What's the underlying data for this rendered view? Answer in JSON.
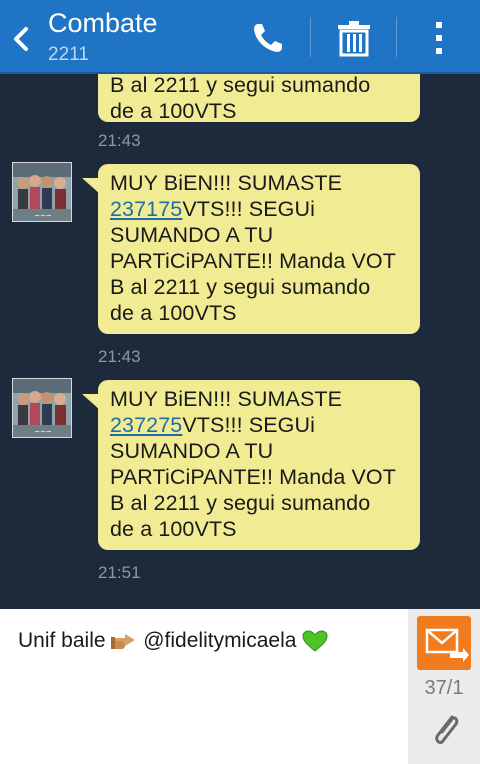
{
  "header": {
    "title": "Combate",
    "subtitle": "2211",
    "icons": {
      "back": "chevron-left-icon",
      "call": "phone-icon",
      "delete": "trash-icon",
      "more": "more-vert-icon"
    },
    "color": "#1f74c6"
  },
  "messages": [
    {
      "partial": true,
      "lines": [
        "B al 2211 y segui sumando",
        "de a 100VTS"
      ],
      "time": "21:43"
    },
    {
      "line1": "MUY BiEN!!! SUMASTE",
      "link": "237175",
      "after_link": "VTS!!! SEGUi",
      "lines": [
        "SUMANDO A TU",
        "PARTiCiPANTE!! Manda VOT",
        "B al 2211 y segui sumando",
        "de a 100VTS"
      ],
      "time": "21:43"
    },
    {
      "line1": "MUY BiEN!!! SUMASTE",
      "link": "237275",
      "after_link": "VTS!!! SEGUi",
      "lines": [
        "SUMANDO A TU",
        "PARTiCiPANTE!! Manda VOT",
        "B al 2211 y segui sumando",
        "de a 100VTS"
      ],
      "time": "21:51"
    }
  ],
  "compose": {
    "text_before": "Unif baile ",
    "text_mid": " @fidelitymicaela ",
    "emoji1": "pointing-hand-emoji",
    "emoji2": "green-heart-emoji",
    "counter": "37/1"
  },
  "colors": {
    "bubble": "#f1eb93",
    "background": "#1c2a3c",
    "send": "#f07c1f"
  }
}
